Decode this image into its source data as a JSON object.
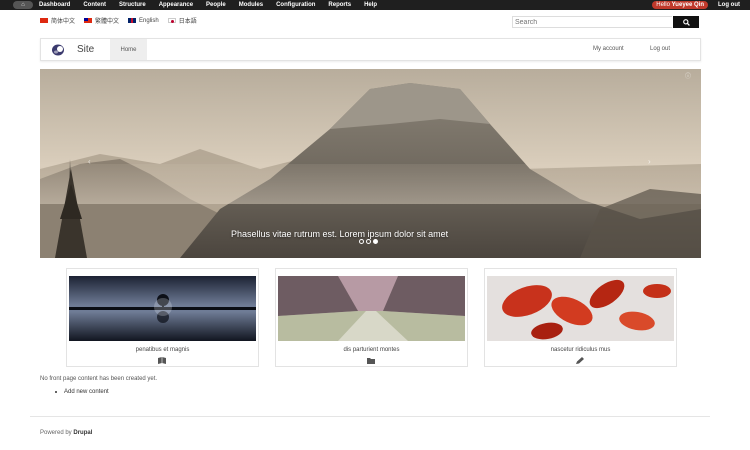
{
  "admin_toolbar": {
    "items": [
      "Dashboard",
      "Content",
      "Structure",
      "Appearance",
      "People",
      "Modules",
      "Configuration",
      "Reports",
      "Help"
    ],
    "hello_prefix": "Hello",
    "user_name": "Yueyee Qin",
    "logout": "Log out"
  },
  "languages": [
    {
      "label": "简体中文",
      "flag": "cn"
    },
    {
      "label": "繁體中文",
      "flag": "tw"
    },
    {
      "label": "English",
      "flag": "gb"
    },
    {
      "label": "日本語",
      "flag": "jp"
    }
  ],
  "search": {
    "placeholder": "Search"
  },
  "navbar": {
    "site_name": "Site",
    "home": "Home",
    "my_account": "My account",
    "logout": "Log out"
  },
  "hero": {
    "caption": "Phasellus vitae rutrum est. Lorem ipsum dolor sit amet",
    "slide_count": 3,
    "active_slide": 3
  },
  "cards": [
    {
      "title": "penatibus et magnis",
      "icon": "book-icon"
    },
    {
      "title": "dis parturient montes",
      "icon": "folder-icon"
    },
    {
      "title": "nascetur ridiculus mus",
      "icon": "pencil-icon"
    }
  ],
  "main": {
    "no_content": "No front page content has been created yet.",
    "add_content": "Add new content"
  },
  "footer": {
    "prefix": "Powered by",
    "brand": "Drupal"
  },
  "colors": {
    "admin_bar": "#1f1f1f",
    "hello_badge": "#c0392b",
    "search_button": "#111111"
  }
}
